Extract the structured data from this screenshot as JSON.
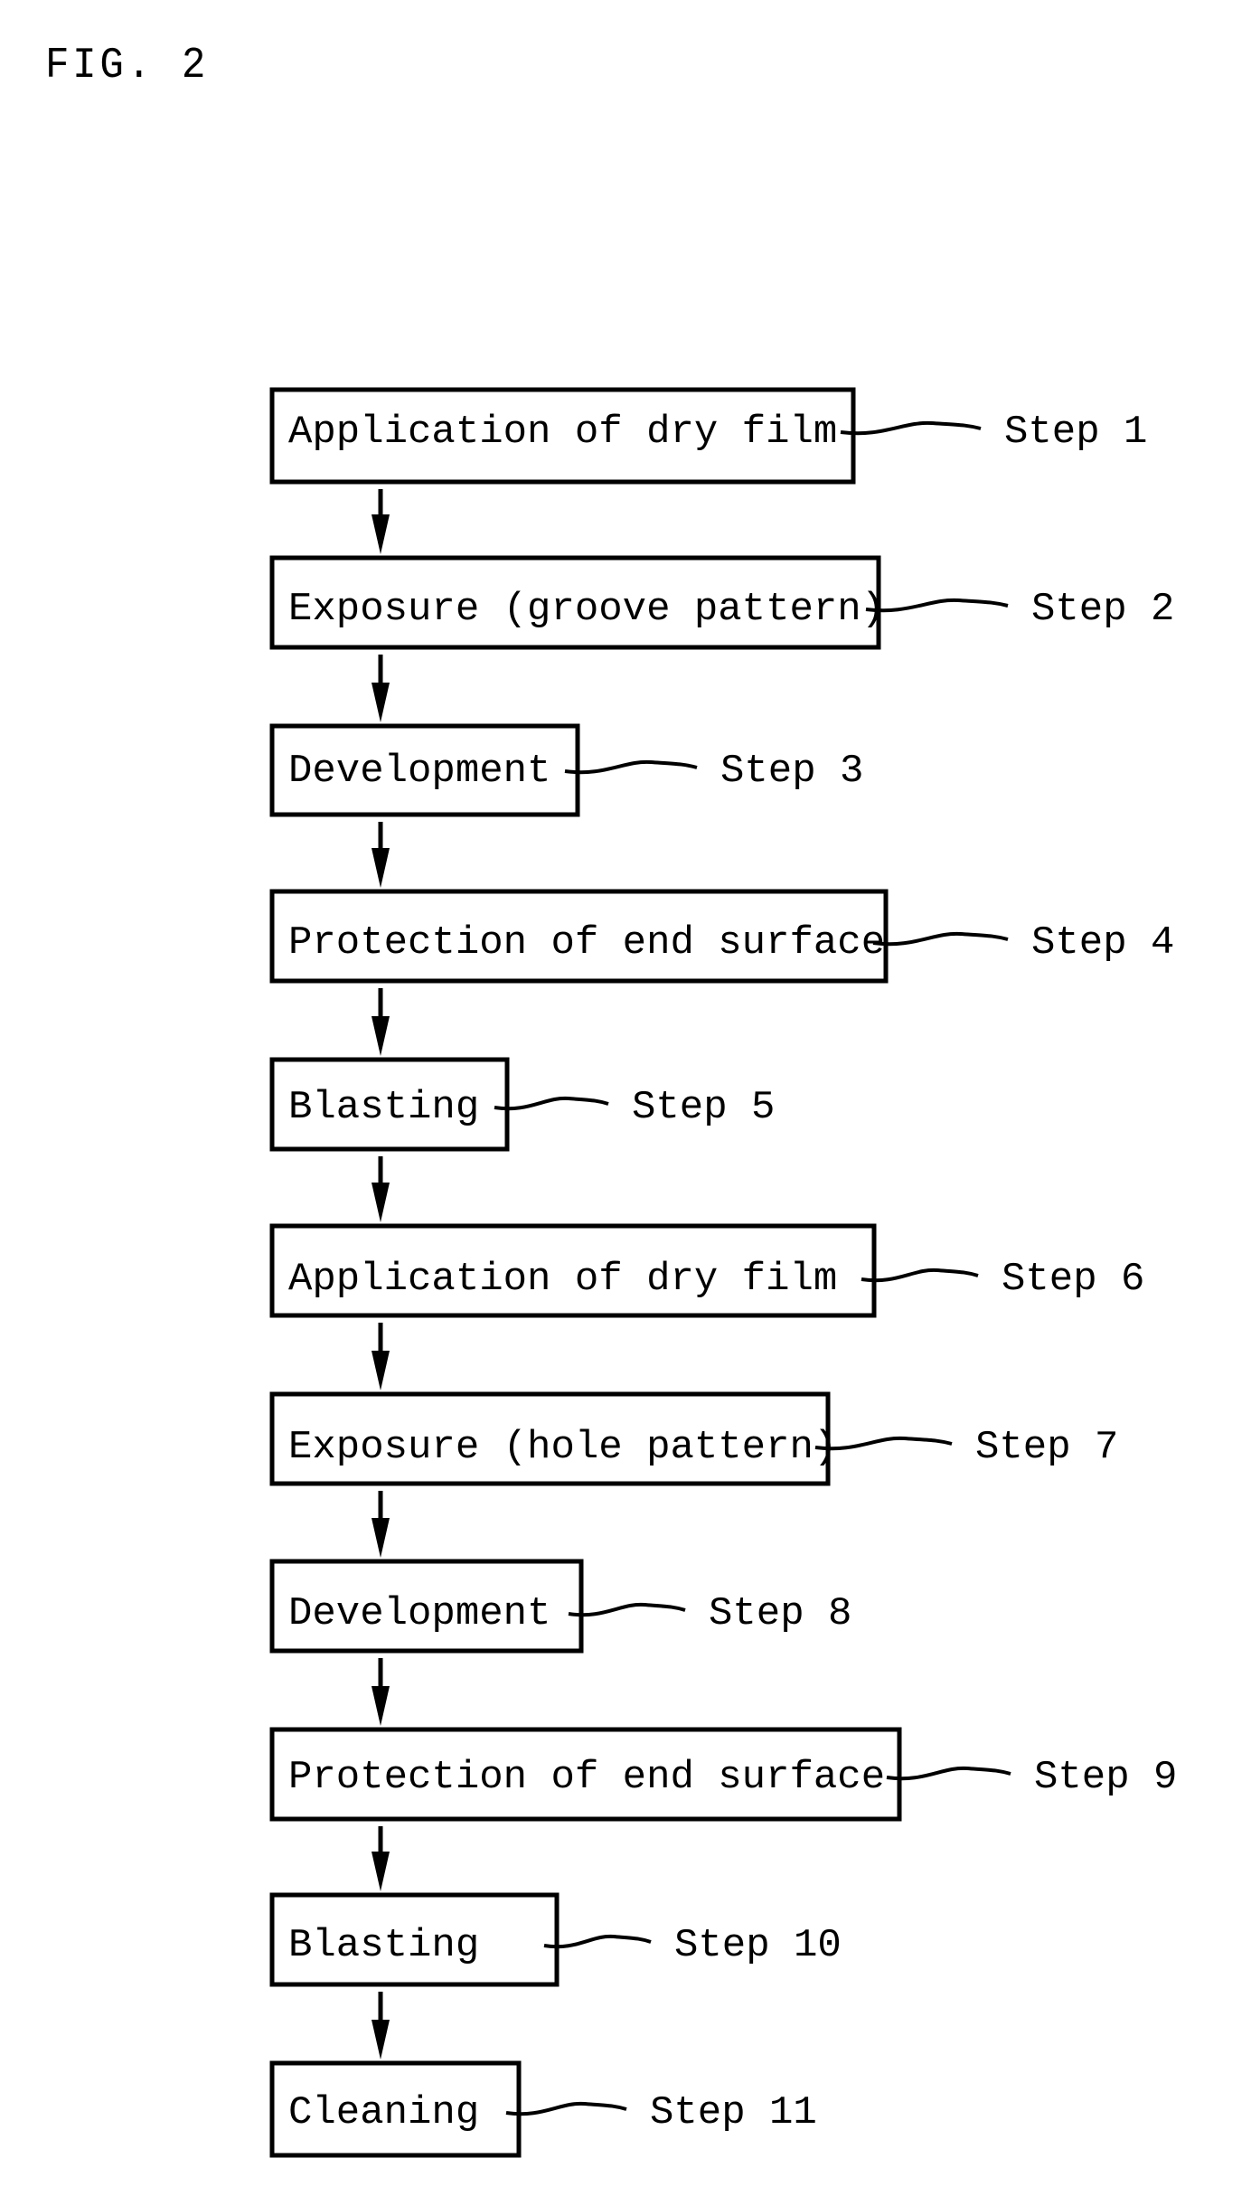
{
  "figure": {
    "title": "FIG. 2"
  },
  "flowchart": {
    "steps": [
      {
        "label": "Application of dry film",
        "step": "Step 1"
      },
      {
        "label": "Exposure (groove pattern)",
        "step": "Step 2"
      },
      {
        "label": "Development",
        "step": "Step 3"
      },
      {
        "label": "Protection of end surface",
        "step": "Step 4"
      },
      {
        "label": "Blasting",
        "step": "Step 5"
      },
      {
        "label": "Application of dry film",
        "step": "Step 6"
      },
      {
        "label": "Exposure (hole pattern)",
        "step": "Step 7"
      },
      {
        "label": "Development",
        "step": "Step 8"
      },
      {
        "label": "Protection of end surface",
        "step": "Step 9"
      },
      {
        "label": "Blasting",
        "step": "Step 10"
      },
      {
        "label": "Cleaning",
        "step": "Step 11"
      }
    ],
    "connector": "arrow-down",
    "colors": {
      "stroke": "#000000",
      "background": "#ffffff"
    }
  }
}
